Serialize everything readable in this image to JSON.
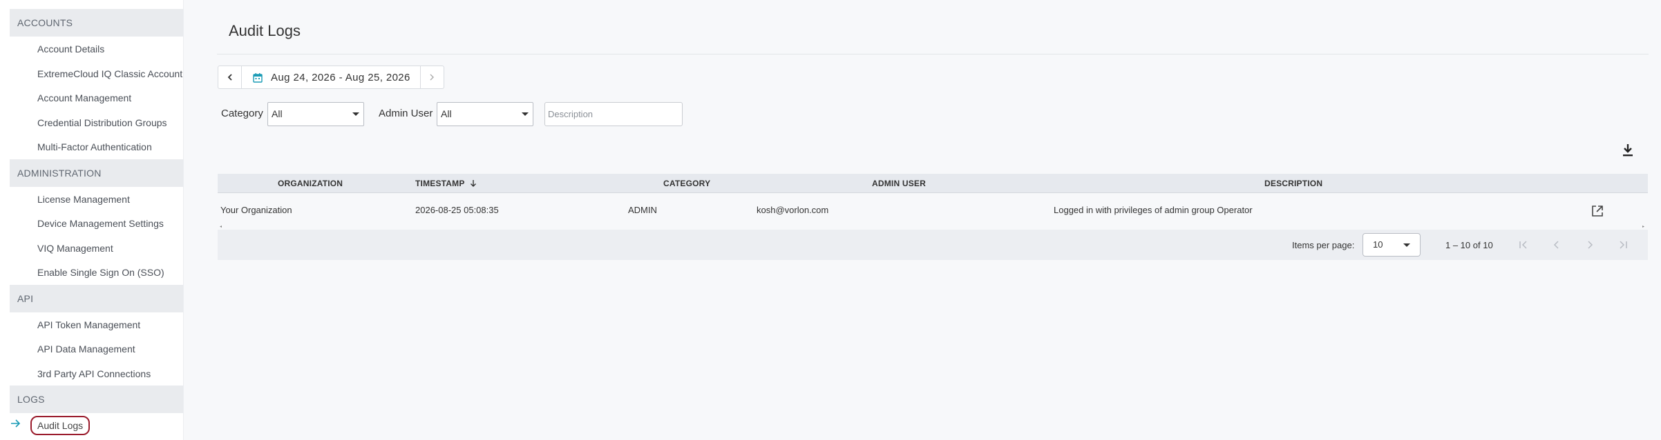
{
  "sidebar": {
    "sections": [
      {
        "label": "ACCOUNTS",
        "items": [
          "Account Details",
          "ExtremeCloud IQ Classic Account",
          "Account Management",
          "Credential Distribution Groups",
          "Multi-Factor Authentication"
        ]
      },
      {
        "label": "ADMINISTRATION",
        "items": [
          "License Management",
          "Device Management Settings",
          "VIQ Management",
          "Enable Single Sign On (SSO)"
        ]
      },
      {
        "label": "API",
        "items": [
          "API Token Management",
          "API Data Management",
          "3rd Party API Connections"
        ]
      },
      {
        "label": "LOGS",
        "items": [
          "Audit Logs"
        ]
      }
    ]
  },
  "page": {
    "title": "Audit Logs",
    "date_range": "Aug 24, 2026 - Aug 25, 2026"
  },
  "filters": {
    "category_label": "Category",
    "category_value": "All",
    "admin_user_label": "Admin User",
    "admin_user_value": "All",
    "description_placeholder": "Description"
  },
  "table": {
    "columns": [
      "ORGANIZATION",
      "TIMESTAMP",
      "CATEGORY",
      "ADMIN USER",
      "DESCRIPTION"
    ],
    "rows": [
      {
        "organization": "Your Organization",
        "timestamp": "2026-08-25 05:08:35",
        "category": "ADMIN",
        "admin_user": "kosh@vorlon.com",
        "description": "Logged in with privileges of admin group Operator"
      }
    ]
  },
  "paginator": {
    "items_per_page_label": "Items per page:",
    "items_per_page_value": "10",
    "range_label": "1 – 10 of 10"
  },
  "icons": {
    "calendar": "calendar-icon",
    "download": "download-icon",
    "open": "open-in-new-icon",
    "arrow": "arrow-right-icon"
  },
  "colors": {
    "accent": "#1a9bb5",
    "active_outline": "#9a1b2c"
  }
}
